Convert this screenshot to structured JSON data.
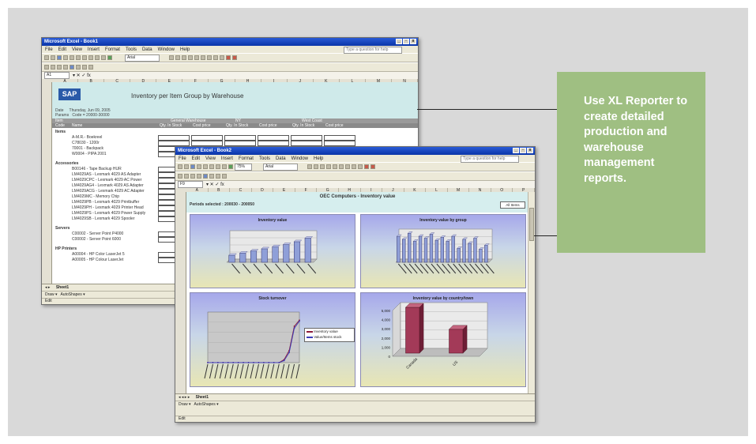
{
  "callout": {
    "text": "Use XL Reporter to create detailed production and warehouse management reports."
  },
  "window_back": {
    "title": "Microsoft Excel - Book1",
    "menu": [
      "File",
      "Edit",
      "View",
      "Insert",
      "Format",
      "Tools",
      "Data",
      "Window",
      "Help"
    ],
    "help_placeholder": "Type a question for help",
    "font_name": "Arial",
    "name_box": "A1",
    "columns": [
      "A",
      "B",
      "C",
      "D",
      "E",
      "F",
      "G",
      "H",
      "I",
      "J",
      "K",
      "L",
      "M",
      "N"
    ],
    "report": {
      "logo": "SAP",
      "title": "Inventory per Item Group by Warehouse",
      "date_label": "Date",
      "date_value": "Thursday, Jun 09, 2005",
      "params_label": "Params",
      "params_value": "Code = 20000-30000",
      "header_row1": [
        "Item",
        "General Warehouse",
        "NY",
        "West Coast"
      ],
      "header_row2": [
        "Code",
        "Name",
        "Qty. In Stock",
        "Cost price",
        "Qty. In Stock",
        "Cost price",
        "Qty. In Stock",
        "Cost price"
      ],
      "groups": [
        {
          "name": "Items",
          "items": [
            "A-M.R.- Boekreel",
            "C78030 - 1200r",
            "70001 - Backpack",
            "W0004 - PIPA 2001"
          ]
        },
        {
          "name": "Accessories",
          "items": [
            "B00146 - Tape Backup HUR",
            "LM4029AS - Lexmark 4029 AS Adapter",
            "LM4029CPC - Lexmark 4029 AC Power",
            "LM4029AG4 - Lexmark 4029 AS Adapter",
            "LM4029ACG - Lexmark 4029 AC Adapter",
            "LM4029MC - Memory Chip",
            "LM4029PB - Lexmark 4029 Printbuffer",
            "LM4029PH - Lexmark 4029 Printer Head",
            "LM4029PS - Lexmark 4029 Power Supply",
            "LM4029SB - Lexmark 4029 Spooler"
          ]
        },
        {
          "name": "Servers",
          "items": [
            "C00002 - Server Point P4000",
            "C00002 - Server Point 6000"
          ]
        },
        {
          "name": "HP Printers",
          "items": [
            "A00004 - HP Color LaserJet 5",
            "A00005 - HP Colour LaserJet"
          ]
        }
      ]
    },
    "sheet_tab": "Sheet1",
    "draw_menu": "Draw",
    "autoshapes": "AutoShapes",
    "status": "Edit"
  },
  "window_front": {
    "title": "Microsoft Excel - Book2",
    "menu": [
      "File",
      "Edit",
      "View",
      "Insert",
      "Format",
      "Tools",
      "Data",
      "Window",
      "Help"
    ],
    "help_placeholder": "Type a question for help",
    "font_name": "Arial",
    "zoom": "75%",
    "name_box": "F9",
    "columns": [
      "A",
      "B",
      "C",
      "D",
      "E",
      "F",
      "G",
      "H",
      "I",
      "J",
      "K",
      "L",
      "M",
      "N",
      "O",
      "P"
    ],
    "sheet_title": "OEC Computers - Inventory value",
    "period": "Periods selected : 200030 - 200050",
    "corner_label": "All Items",
    "sheet_tab": "Sheet1",
    "draw_menu": "Draw",
    "autoshapes": "AutoShapes",
    "status": "Edit",
    "charts": [
      {
        "title": "Inventory value"
      },
      {
        "title": "Inventory value by group"
      },
      {
        "title": "Stock turnover",
        "legend": [
          "Inventory value",
          "Value/Items stock"
        ]
      },
      {
        "title": "Inventory value by country/town",
        "categories": [
          "Canada",
          "US"
        ]
      }
    ]
  },
  "chart_data": [
    {
      "type": "bar",
      "title": "Inventory value",
      "values": [
        1,
        1.3,
        1.6,
        1.9,
        2.2,
        2.5,
        2.9,
        3.4
      ],
      "ylim": [
        0,
        4
      ]
    },
    {
      "type": "bar",
      "title": "Inventory value by group",
      "values": [
        2.6,
        2.3,
        2.9,
        2.1,
        2.6,
        2.4,
        2.8,
        2.2,
        2.5,
        2.1,
        2.6,
        1.4,
        2.3,
        1.9,
        2.4,
        1.3,
        1.7
      ],
      "ylim": [
        0,
        3
      ]
    },
    {
      "type": "line",
      "title": "Stock turnover",
      "series": [
        {
          "name": "Inventory value",
          "values": [
            0,
            0,
            0,
            0,
            0,
            0,
            0,
            0,
            0,
            0,
            0,
            0,
            0,
            0,
            0,
            0.3,
            1.2,
            3.6,
            4.2
          ]
        },
        {
          "name": "Value/Items stock",
          "values": [
            0,
            0,
            0,
            0,
            0,
            0,
            0,
            0,
            0,
            0,
            0,
            0,
            0,
            0,
            0,
            0.2,
            1.0,
            3.4,
            4.1
          ]
        }
      ],
      "ylim": [
        0,
        5
      ]
    },
    {
      "type": "bar",
      "title": "Inventory value by country/town",
      "categories": [
        "Canada",
        "US"
      ],
      "values": [
        5000,
        2600
      ],
      "yticks": [
        "0",
        "1,000",
        "2,000",
        "3,000",
        "4,000",
        "5,000"
      ],
      "ylim": [
        0,
        5000
      ]
    }
  ]
}
